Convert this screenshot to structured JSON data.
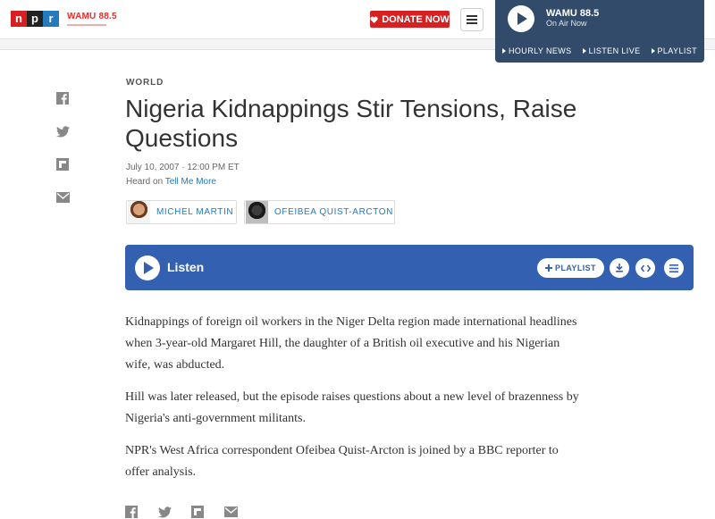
{
  "header": {
    "logo_letters": [
      "n",
      "p",
      "r"
    ],
    "station_logo": "WAMU 88.5",
    "donate_label": "DONATE NOW",
    "colors": {
      "npr_red": "#d62021",
      "npr_black": "#222222",
      "npr_blue": "#237bbd",
      "player_bg": "#324b6b"
    }
  },
  "player": {
    "station": "WAMU 88.5",
    "status": "On Air Now",
    "links": [
      "HOURLY NEWS",
      "LISTEN LIVE",
      "PLAYLIST"
    ]
  },
  "share": {
    "icons": [
      "facebook-icon",
      "twitter-icon",
      "flipboard-icon",
      "email-icon"
    ]
  },
  "article": {
    "slug": "WORLD",
    "title": "Nigeria Kidnappings Stir Tensions, Raise Questions",
    "date": "July 10, 2007 · 12:00 PM ET",
    "heard_on_prefix": "Heard on",
    "heard_on_program": "Tell Me More",
    "bylines": [
      {
        "name": "MICHEL MARTIN"
      },
      {
        "name": "OFEIBEA QUIST-ARCTON"
      }
    ]
  },
  "audio": {
    "label": "Listen",
    "playlist_label": "PLAYLIST",
    "accent": "#3460b1"
  },
  "body": {
    "paragraphs": [
      "Kidnappings of foreign oil workers in the Niger Delta region made international headlines when 3-year-old Margaret Hill, the daughter of a British oil executive and his Nigerian wife, was abducted.",
      "Hill was later released, but the episode raises questions about a new level of brazenness by Nigeria's anti-government militants.",
      "NPR's West Africa correspondent Ofeibea Quist-Arcton is joined by a BBC reporter to offer analysis."
    ]
  }
}
